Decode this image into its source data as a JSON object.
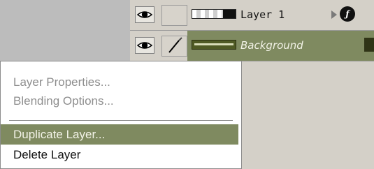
{
  "layers": [
    {
      "name": "Layer 1",
      "selected": false,
      "visible": true,
      "has_effects": true,
      "link_icon": "empty"
    },
    {
      "name": "Background",
      "selected": true,
      "visible": true,
      "has_effects": false,
      "link_icon": "brush-icon"
    }
  ],
  "context_menu": {
    "items": [
      {
        "label": "Layer Properties...",
        "enabled": false,
        "highlighted": false
      },
      {
        "label": "Blending Options...",
        "enabled": false,
        "highlighted": false
      },
      {
        "label": "Duplicate Layer...",
        "enabled": true,
        "highlighted": true
      },
      {
        "label": "Delete Layer",
        "enabled": true,
        "highlighted": false
      }
    ]
  },
  "colors": {
    "selection": "#7f8a60",
    "panel": "#d4d0c8",
    "background": "#bcbcbc"
  },
  "icons": {
    "visibility": "eye-icon",
    "effects": "fx-icon",
    "expand": "triangle-right-icon",
    "paint": "brush-icon"
  }
}
